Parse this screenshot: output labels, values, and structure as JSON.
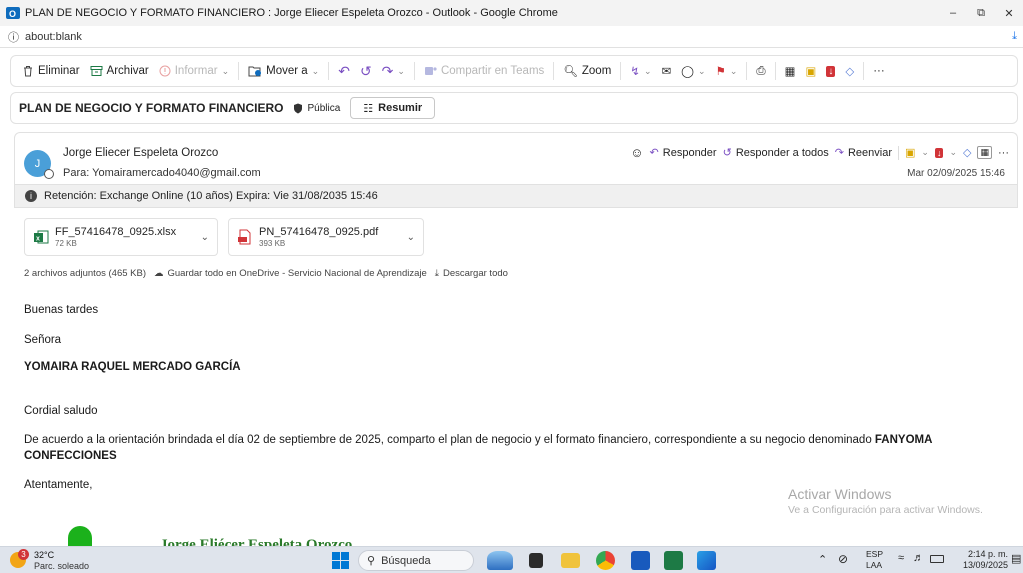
{
  "window": {
    "title": "PLAN DE NEGOCIO Y FORMATO FINANCIERO : Jorge Eliecer Espeleta Orozco - Outlook - Google Chrome",
    "address": "about:blank"
  },
  "toolbar": {
    "eliminar": "Eliminar",
    "archivar": "Archivar",
    "informar": "Informar",
    "mover": "Mover a",
    "teams": "Compartir en Teams",
    "zoom": "Zoom",
    "more": "···"
  },
  "subject": {
    "text": "PLAN DE NEGOCIO Y FORMATO FINANCIERO",
    "sensitivity": "Pública",
    "summarize": "Resumir"
  },
  "message": {
    "avatar_initial": "J",
    "sender": "Jorge Eliecer Espeleta Orozco",
    "to": "Para:  Yomairamercado4040@gmail.com",
    "date": "Mar 02/09/2025 15:46",
    "actions": {
      "reply": "Responder",
      "reply_all": "Responder a todos",
      "forward": "Reenviar"
    },
    "retention": "Retención: Exchange Online (10 años) Expira: Vie 31/08/2035 15:46"
  },
  "attachments": [
    {
      "name": "FF_57416478_0925.xlsx",
      "size": "72 KB",
      "type": "excel"
    },
    {
      "name": "PN_57416478_0925.pdf",
      "size": "393 KB",
      "type": "pdf"
    }
  ],
  "attachments_bar": {
    "summary": "2 archivos adjuntos (465 KB)",
    "save_onedrive": "Guardar todo en OneDrive - Servicio Nacional de Aprendizaje",
    "download_all": "Descargar todo"
  },
  "body": {
    "greeting": "Buenas tardes",
    "title": "Señora",
    "recipient_name": "YOMAIRA RAQUEL MERCADO GARCÍA",
    "salutation": "Cordial saludo",
    "paragraph_part1": "De acuerdo a la orientación brindada el día 02 de septiembre de 2025, comparto el plan de negocio y el formato financiero, correspondiente a su negocio denominado ",
    "business_name_line1": "FANYOMA",
    "business_name_line2": "CONFECCIONES",
    "closing": "Atentamente,",
    "signature_name": "Jorge Eliécer Espeleta Orozco"
  },
  "watermark": {
    "line1": "Activar Windows",
    "line2": "Ve a Configuración para activar Windows."
  },
  "taskbar": {
    "weather_badge": "3",
    "temperature": "32°C",
    "weather_desc": "Parc. soleado",
    "search_placeholder": "Búsqueda",
    "lang_line1": "ESP",
    "lang_line2": "LAA",
    "time": "2:14 p. m.",
    "date": "13/09/2025"
  },
  "colors": {
    "accent": "#0f6cbd",
    "avatar": "#4a9fd8",
    "excel": "#1d7a45",
    "pdf": "#d13438",
    "signature_green": "#2a7a2a"
  }
}
